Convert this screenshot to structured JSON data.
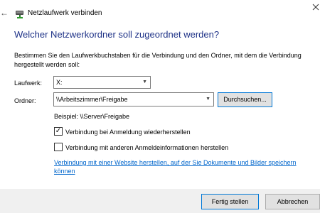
{
  "window": {
    "title": "Netzlaufwerk verbinden",
    "back_glyph": "←"
  },
  "heading": "Welcher Netzwerkordner soll zugeordnet werden?",
  "description": "Bestimmen Sie den Laufwerkbuchstaben für die Verbindung und den Ordner, mit dem die Verbindung hergestellt werden soll:",
  "drive": {
    "label": "Laufwerk:",
    "value": "X:"
  },
  "folder": {
    "label": "Ordner:",
    "value": "\\\\Arbeitszimmer\\Freigabe",
    "browse_label": "Durchsuchen...",
    "example": "Beispiel: \\\\Server\\Freigabe"
  },
  "options": {
    "reconnect": {
      "label": "Verbindung bei Anmeldung wiederherstellen",
      "checked": true,
      "mark": "✓"
    },
    "other_credentials": {
      "label": "Verbindung mit anderen Anmeldeinformationen herstellen",
      "checked": false,
      "mark": ""
    }
  },
  "link_text": "Verbindung mit einer Website herstellen, auf der Sie Dokumente und Bilder speichern können",
  "footer": {
    "finish_label": "Fertig stellen",
    "cancel_label": "Abbrechen"
  },
  "icons": {
    "back": "back-arrow-icon",
    "title": "network-drive-icon",
    "close": "close-icon",
    "dropdown": "chevron-down-icon",
    "check": "checkmark-icon"
  },
  "colors": {
    "heading": "#1e3287",
    "link": "#0066cc",
    "accent_border": "#0078d7",
    "footer_bg": "#f0f0f0"
  }
}
